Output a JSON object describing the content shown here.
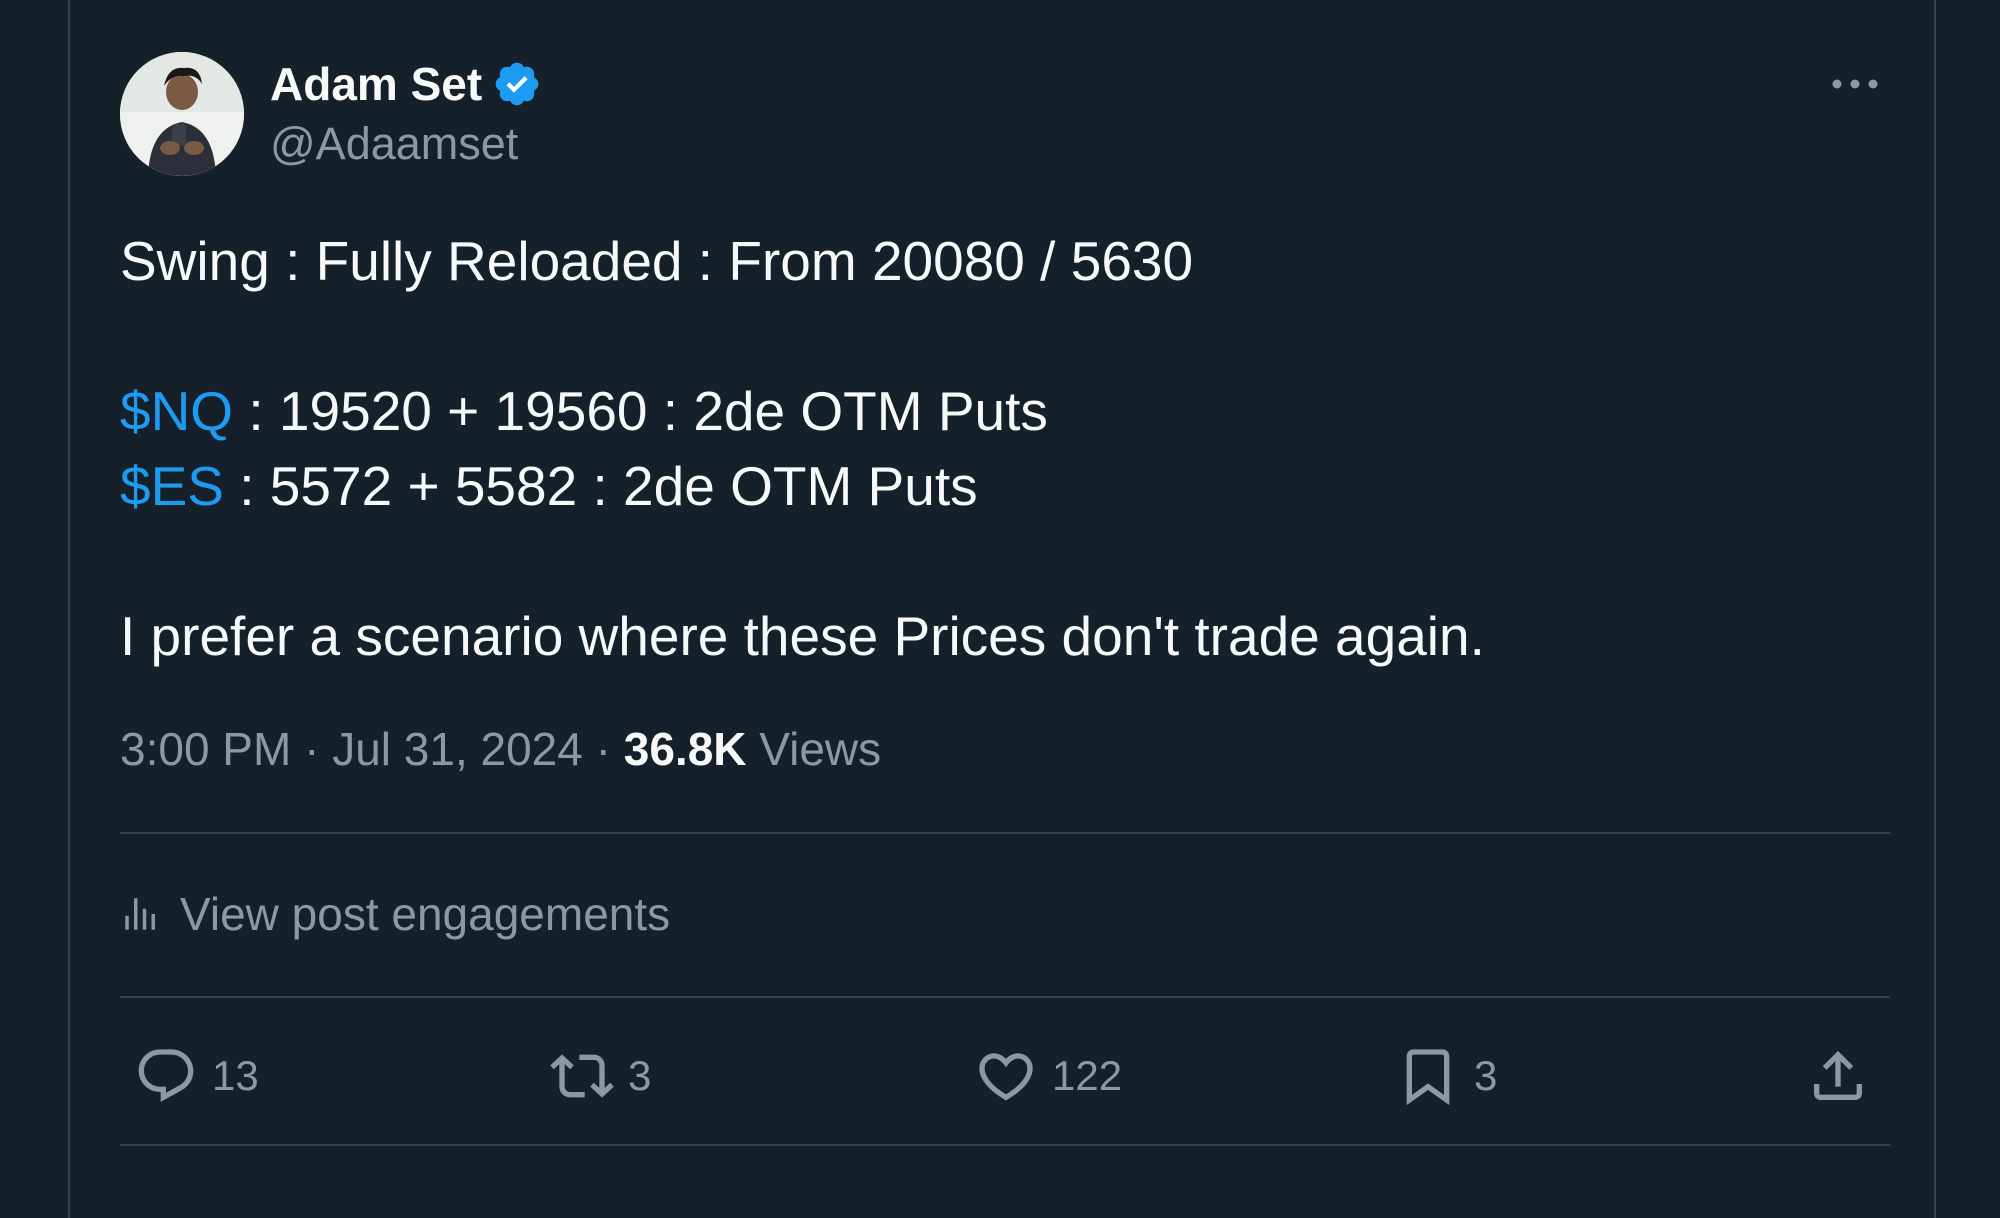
{
  "author": {
    "display_name": "Adam Set",
    "handle": "@Adaamset",
    "verified": true
  },
  "post": {
    "line1": "Swing : Fully Reloaded : From 20080 / 5630",
    "nq_tag": "$NQ",
    "nq_rest": " : 19520 + 19560 : 2de OTM Puts",
    "es_tag": "$ES",
    "es_rest": " : 5572 + 5582 : 2de OTM Puts",
    "line4": "I prefer a scenario where these Prices don't trade again."
  },
  "meta": {
    "time": "3:00 PM",
    "separator": "·",
    "date": "Jul 31, 2024",
    "views_count": "36.8K",
    "views_label": "Views"
  },
  "engagements_label": "View post engagements",
  "actions": {
    "replies": "13",
    "reposts": "3",
    "likes": "122",
    "bookmarks": "3"
  },
  "colors": {
    "background": "#15202b",
    "accent": "#1d9bf0",
    "muted_text": "#8b98a5",
    "border": "#38444d"
  },
  "icons": [
    "verified-badge-icon",
    "more-icon",
    "analytics-icon",
    "reply-icon",
    "repost-icon",
    "like-icon",
    "bookmark-icon",
    "share-icon"
  ]
}
